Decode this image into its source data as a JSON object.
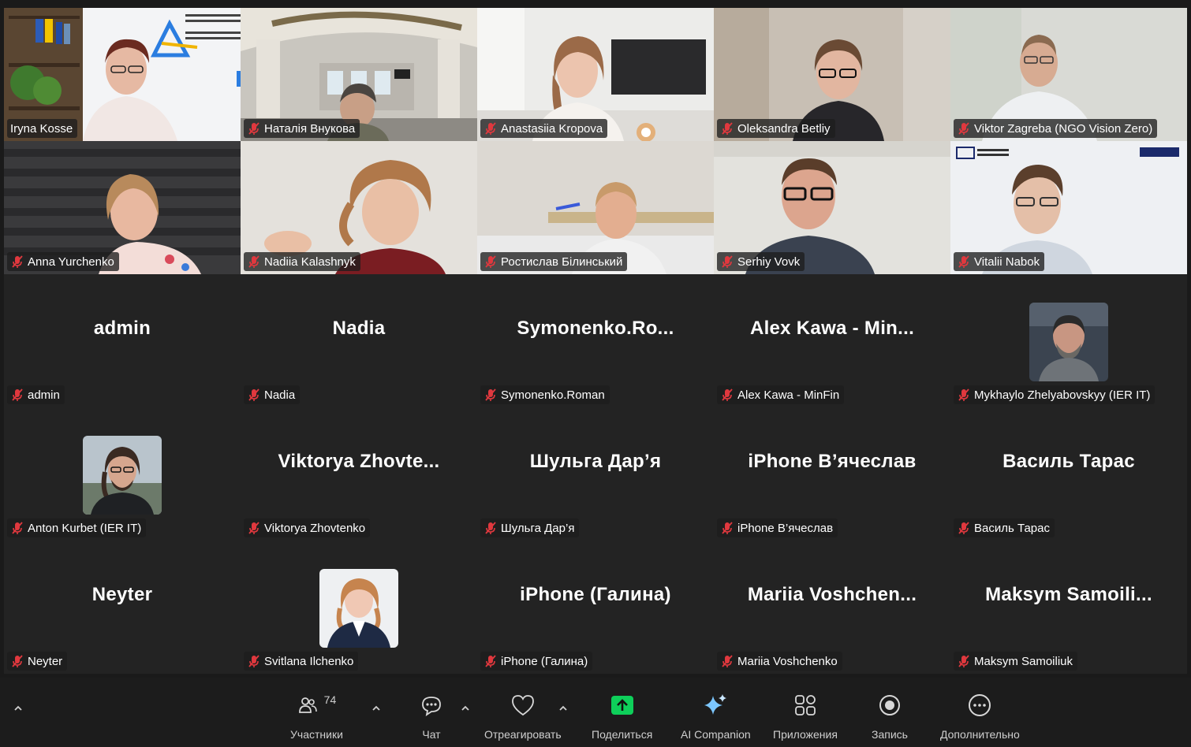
{
  "participants": {
    "row1": [
      {
        "name": "Iryna Kosse"
      },
      {
        "name": "Наталія Внукова"
      },
      {
        "name": "Anastasiia Kropova"
      },
      {
        "name": "Oleksandra Betliy"
      },
      {
        "name": "Viktor Zagreba (NGO Vision Zero)"
      }
    ],
    "row2": [
      {
        "name": "Anna Yurchenko"
      },
      {
        "name": "Nadiia Kalashnyk"
      },
      {
        "name": "Ростислав Білинський"
      },
      {
        "name": "Serhiy Vovk"
      },
      {
        "name": "Vitalii Nabok"
      }
    ],
    "row3": [
      {
        "display": "admin",
        "name": "admin"
      },
      {
        "display": "Nadia",
        "name": "Nadia"
      },
      {
        "display": "Symonenko.Ro...",
        "name": "Symonenko.Roman"
      },
      {
        "display": "Alex Kawa - Min...",
        "name": "Alex Kawa - MinFin"
      },
      {
        "display": "",
        "name": "Mykhaylo Zhelyabovskyy (IER IT)"
      }
    ],
    "row4": [
      {
        "display": "",
        "name": "Anton Kurbet (IER IT)"
      },
      {
        "display": "Viktorya Zhovte...",
        "name": "Viktorya Zhovtenko"
      },
      {
        "display": "Шульга Дар’я",
        "name": "Шульга Дар’я"
      },
      {
        "display": "iPhone В’ячеслав",
        "name": "iPhone В’ячеслав"
      },
      {
        "display": "Василь Тарас",
        "name": "Василь Тарас"
      }
    ],
    "row5": [
      {
        "display": "Neyter",
        "name": "Neyter"
      },
      {
        "display": "",
        "name": "Svitlana Ilchenko"
      },
      {
        "display": "iPhone (Галина)",
        "name": "iPhone (Галина)"
      },
      {
        "display": "Mariia Voshchen...",
        "name": "Mariia Voshchenko"
      },
      {
        "display": "Maksym Samoili...",
        "name": "Maksym Samoiliuk"
      }
    ]
  },
  "toolbar": {
    "participants_label": "Участники",
    "participants_count": "74",
    "chat_label": "Чат",
    "react_label": "Отреагировать",
    "share_label": "Поделиться",
    "ai_label": "AI Companion",
    "apps_label": "Приложения",
    "record_label": "Запись",
    "more_label": "Дополнительно"
  },
  "colors": {
    "active_speaker": "#2bd96a",
    "share_green": "#0ecf5a",
    "mic_muted": "#e0383e",
    "tile_bg": "#232323"
  }
}
